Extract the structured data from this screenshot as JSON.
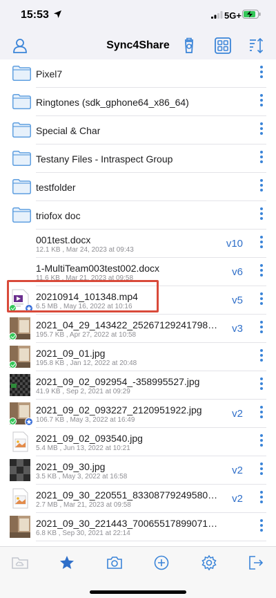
{
  "status_bar": {
    "time": "15:53",
    "network": "5G+"
  },
  "nav": {
    "title": "Sync4Share"
  },
  "colors": {
    "accent": "#3a84d8",
    "version": "#2f6fc9",
    "highlight": "#d94a3a",
    "synced": "#34c759"
  },
  "folders": [
    {
      "name": "Pixel7"
    },
    {
      "name": "Ringtones (sdk_gphone64_x86_64)"
    },
    {
      "name": "Special & Char"
    },
    {
      "name": "Testany Files - Intraspect Group"
    },
    {
      "name": "testfolder"
    },
    {
      "name": "triofox doc"
    }
  ],
  "files": [
    {
      "name": "001test.docx",
      "meta": "12.1 KB , Mar 24, 2023 at 09:43",
      "version": "v10",
      "thumb": "blank",
      "synced": false,
      "starred": false
    },
    {
      "name": "1-MultiTeam003test002.docx",
      "meta": "11.6 KB , Mar 21, 2023 at 09:58",
      "version": "v6",
      "thumb": "blank",
      "synced": false,
      "starred": false
    },
    {
      "name": "20210914_101348.mp4",
      "meta": "6.5 MB , May 16, 2022 at 10:16",
      "version": "v5",
      "thumb": "video-file",
      "synced": true,
      "starred": true
    },
    {
      "name": "2021_04_29_143422_2526712924179811...",
      "meta": "195.7 KB , Apr 27, 2022 at 10:58",
      "version": "v3",
      "thumb": "photo-room",
      "synced": true,
      "starred": false
    },
    {
      "name": "2021_09_01.jpg",
      "meta": "195.8 KB , Jan 12, 2022 at 20:48",
      "version": "",
      "thumb": "photo-room",
      "synced": true,
      "starred": false
    },
    {
      "name": "2021_09_02_092954_-358995527.jpg",
      "meta": "41.9 KB , Sep 2, 2021 at 09:29",
      "version": "",
      "thumb": "checker",
      "synced": false,
      "starred": false
    },
    {
      "name": "2021_09_02_093227_2120951922.jpg",
      "meta": "106.7 KB , May 3, 2022 at 16:49",
      "version": "v2",
      "thumb": "photo-room",
      "synced": true,
      "starred": true
    },
    {
      "name": "2021_09_02_093540.jpg",
      "meta": "5.4 MB , Jun 13, 2022 at 10:21",
      "version": "",
      "thumb": "image-placeholder",
      "synced": false,
      "starred": false
    },
    {
      "name": "2021_09_30.jpg",
      "meta": "3.5 KB , May 3, 2022 at 16:58",
      "version": "v2",
      "thumb": "grey-blocks",
      "synced": false,
      "starred": false
    },
    {
      "name": "2021_09_30_220551_833087792495800...",
      "meta": "2.7 MB , Mar 21, 2023 at 09:58",
      "version": "v2",
      "thumb": "image-placeholder",
      "synced": false,
      "starred": false
    },
    {
      "name": "2021_09_30_221443_7006551789907123...",
      "meta": "6.8 KB , Sep 30, 2021 at 22:14",
      "version": "",
      "thumb": "photo-room",
      "synced": false,
      "starred": false
    }
  ],
  "tabs": [
    {
      "icon": "cloud-folder-icon",
      "active": false,
      "disabled": true
    },
    {
      "icon": "star-icon",
      "active": true,
      "disabled": false
    },
    {
      "icon": "camera-icon",
      "active": false,
      "disabled": false
    },
    {
      "icon": "add-circle-icon",
      "active": false,
      "disabled": false
    },
    {
      "icon": "settings-gear-icon",
      "active": false,
      "disabled": false
    },
    {
      "icon": "logout-icon",
      "active": false,
      "disabled": false
    }
  ]
}
